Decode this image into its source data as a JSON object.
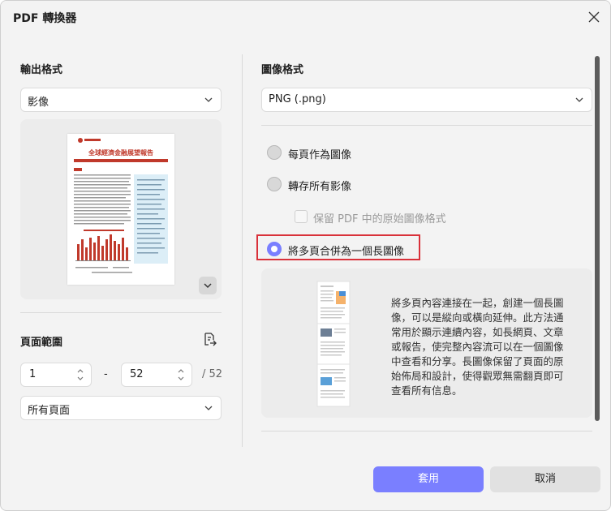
{
  "window": {
    "title": "PDF 轉換器"
  },
  "left": {
    "output_format_title": "輸出格式",
    "output_format_value": "影像",
    "page_range_title": "頁面範圍",
    "range_from": "1",
    "range_dash": "-",
    "range_to": "52",
    "range_total": "/ 52",
    "page_subset": "所有頁面"
  },
  "right": {
    "image_format_title": "圖像格式",
    "image_format_value": "PNG (.png)",
    "options": [
      {
        "label": "每頁作為圖像",
        "selected": false
      },
      {
        "label": "轉存所有影像",
        "selected": false
      },
      {
        "label": "將多頁合併為一個長圖像",
        "selected": true
      }
    ],
    "keep_format_label": "保留 PDF 中的原始圖像格式",
    "description": "將多頁內容連接在一起，創建一個長圖像，可以是縱向或橫向延伸。此方法通常用於顯示連續內容，如長網頁、文章或報告，使完整內容流可以在一個圖像中查看和分享。長圖像保留了頁面的原始佈局和設計，使得觀眾無需翻頁即可查看所有信息。"
  },
  "preview": {
    "doc_title": "全球經濟金融展望報告"
  },
  "footer": {
    "apply_label": "套用",
    "cancel_label": "取消"
  },
  "colors": {
    "accent": "#7a7fff",
    "highlight": "#d9313a"
  }
}
